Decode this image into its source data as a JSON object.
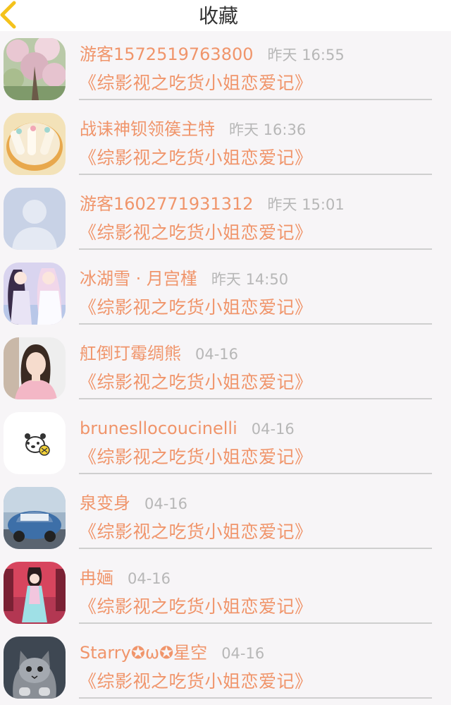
{
  "header": {
    "title": "收藏",
    "back_icon": "chevron-left-icon",
    "accent_color": "#f4c21c"
  },
  "colors": {
    "name": "#f0956b",
    "time": "#b7b7b7",
    "background": "#f7f5f7"
  },
  "favorites": [
    {
      "name": "游客1572519763800",
      "time": "昨天 16:55",
      "book": "《综影视之吃货小姐恋爱记》",
      "avatar": "flowering-tree-photo"
    },
    {
      "name": "战诔神钡领篌主特",
      "time": "昨天 16:36",
      "book": "《综影视之吃货小姐恋爱记》",
      "avatar": "food-rolls-photo"
    },
    {
      "name": "游客1602771931312",
      "time": "昨天 15:01",
      "book": "《综影视之吃货小姐恋爱记》",
      "avatar": "default-user-silhouette"
    },
    {
      "name": "冰湖雪 · 月宫槿",
      "time": "昨天 14:50",
      "book": "《综影视之吃货小姐恋爱记》",
      "avatar": "anime-girls-illustration"
    },
    {
      "name": "舡倒玎霉绸熊",
      "time": "04-16",
      "book": "《综影视之吃货小姐恋爱记》",
      "avatar": "girl-portrait-photo"
    },
    {
      "name": "brunesllocoucinelli",
      "time": "04-16",
      "book": "《综影视之吃货小姐恋爱记》",
      "avatar": "bear-sticker"
    },
    {
      "name": "泉变身",
      "time": "04-16",
      "book": "《综影视之吃货小姐恋爱记》",
      "avatar": "blue-car-photo"
    },
    {
      "name": "冉婳",
      "time": "04-16",
      "book": "《综影视之吃货小姐恋爱记》",
      "avatar": "hanfu-girl-illustration"
    },
    {
      "name": "Starry✪ω✪星空",
      "time": "04-16",
      "book": "《综影视之吃货小姐恋爱记》",
      "avatar": "kitten-photo"
    }
  ]
}
